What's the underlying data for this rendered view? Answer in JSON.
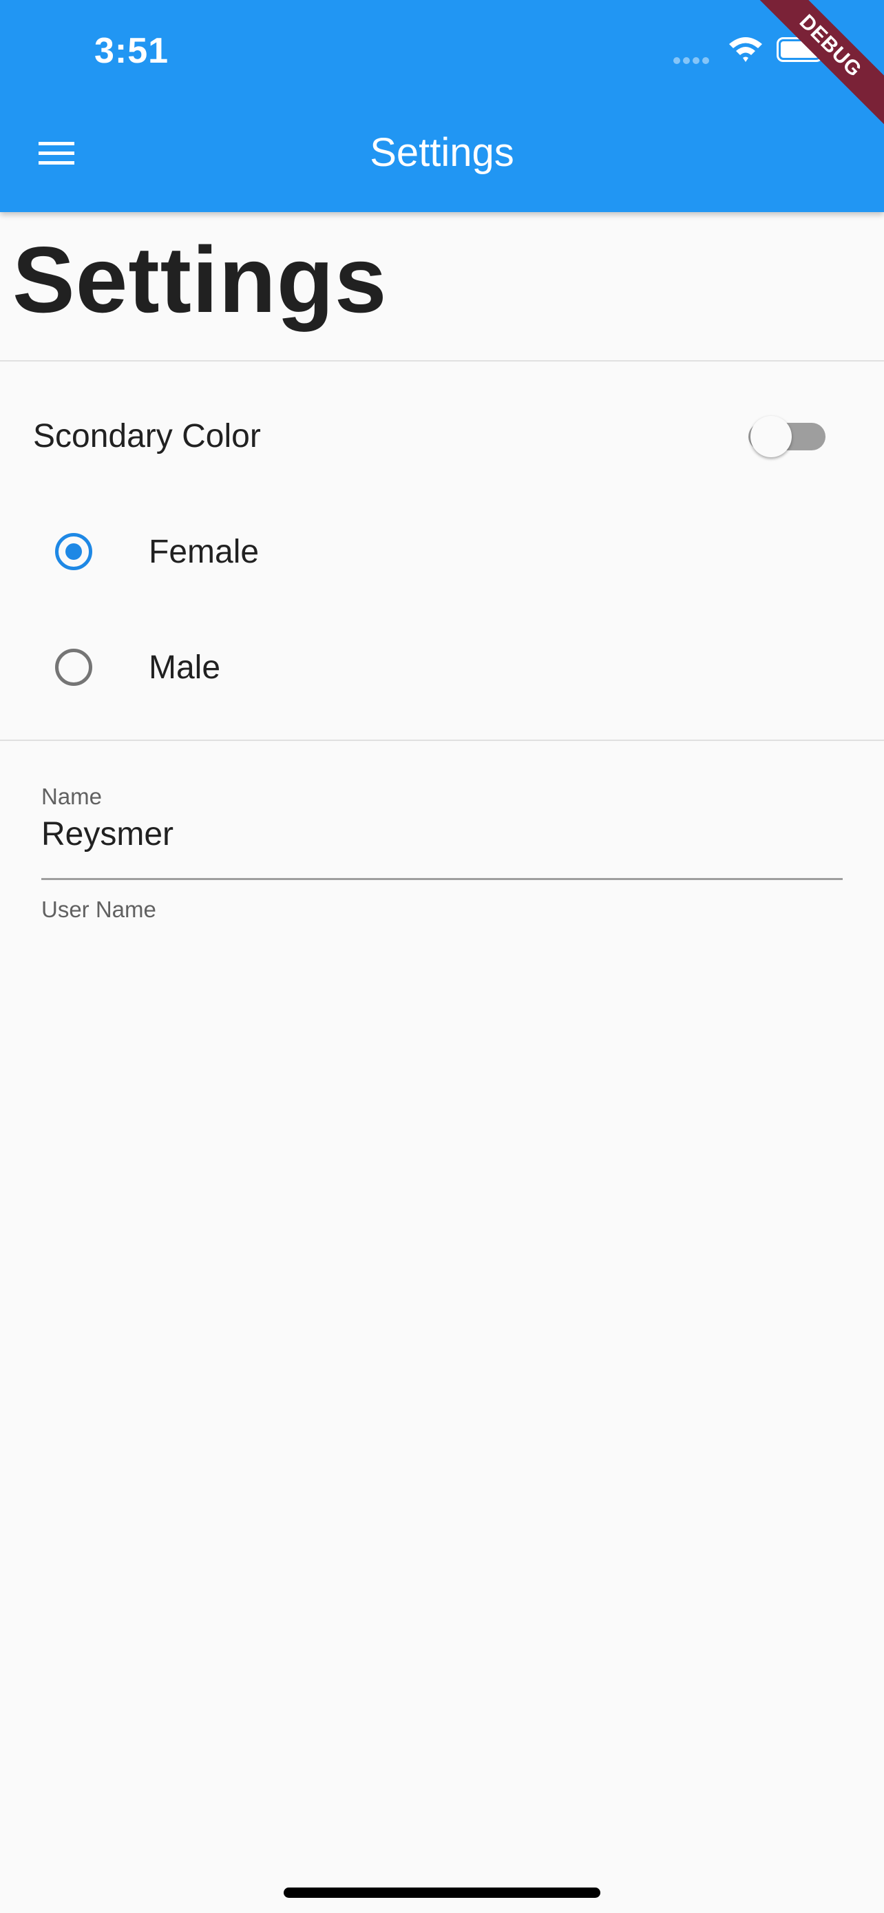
{
  "status_bar": {
    "time": "3:51"
  },
  "app_bar": {
    "title": "Settings",
    "menu_icon": "menu-icon",
    "background_color": "#2196f3"
  },
  "debug_banner": {
    "label": "DEBUG",
    "color": "#7a2237"
  },
  "page": {
    "heading": "Settings"
  },
  "settings": {
    "secondary_color_switch": {
      "label": "Scondary Color",
      "on": false
    },
    "gender": {
      "options": [
        {
          "label": "Female",
          "selected": true
        },
        {
          "label": "Male",
          "selected": false
        }
      ]
    },
    "name_field": {
      "label": "Name",
      "value": "Reysmer"
    },
    "username_field": {
      "label": "User Name"
    }
  },
  "colors": {
    "accent": "#1e88e5",
    "text": "#212121",
    "muted_text": "#616161"
  }
}
